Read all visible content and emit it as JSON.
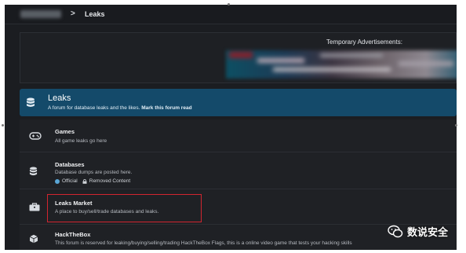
{
  "breadcrumb": {
    "separator": ">",
    "current": "Leaks"
  },
  "ads": {
    "title": "Temporary Advertisements:"
  },
  "forum": {
    "title": "Leaks",
    "description_prefix": "A forum for database leaks and the likes.",
    "mark_read": "Mark this forum read"
  },
  "subforums": [
    {
      "title": "Games",
      "description": "All game leaks go here",
      "icon": "gamepad-icon"
    },
    {
      "title": "Databases",
      "description": "Database dumps are posted here.",
      "icon": "database-icon",
      "legend": {
        "official": "Official",
        "removed": "Removed Content"
      }
    },
    {
      "title": "Leaks Market",
      "description": "A place to buy/sell/trade databases and leaks.",
      "icon": "briefcase-icon"
    },
    {
      "title": "HackTheBox",
      "description": "This forum is reserved for leaking/buying/selling/trading HackTheBox Flags, this is a online video game that tests your hacking skills",
      "icon": "cube-icon"
    }
  ],
  "watermark": {
    "text": "数说安全"
  },
  "colors": {
    "header": "#144a6a",
    "highlight": "#d2252f",
    "background": "#1b1d21"
  }
}
